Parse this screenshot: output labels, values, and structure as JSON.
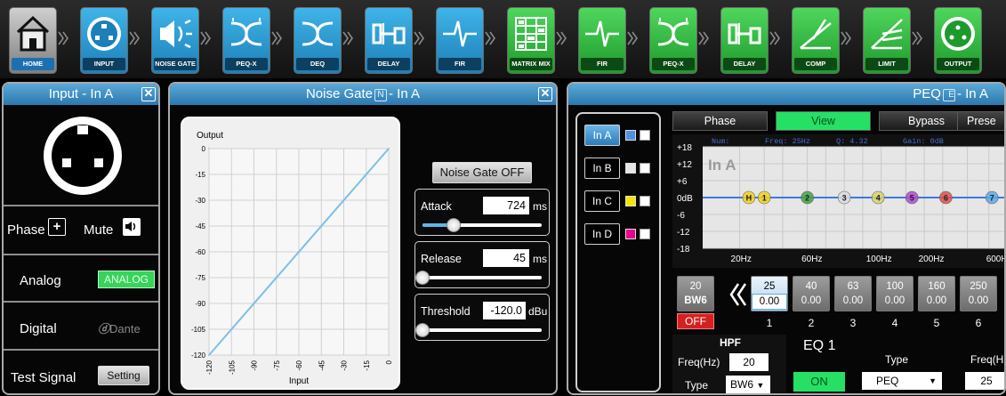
{
  "toolbar": {
    "buttons": [
      {
        "label": "HOME",
        "icon": "home-icon",
        "style": "home"
      },
      {
        "label": "INPUT",
        "icon": "xlr-input-icon",
        "style": "blue"
      },
      {
        "label": "NOISE GATE",
        "icon": "noise-gate-icon",
        "style": "blue"
      },
      {
        "label": "PEQ-X",
        "icon": "peq-x-icon",
        "style": "blue"
      },
      {
        "label": "DEQ",
        "icon": "deq-icon",
        "style": "blue"
      },
      {
        "label": "DELAY",
        "icon": "delay-icon",
        "style": "blue"
      },
      {
        "label": "FIR",
        "icon": "fir-icon",
        "style": "blue"
      },
      {
        "label": "MATRIX MIX",
        "icon": "matrix-icon",
        "style": "green"
      },
      {
        "label": "FIR",
        "icon": "fir-icon",
        "style": "green"
      },
      {
        "label": "PEQ-X",
        "icon": "peq-x-icon",
        "style": "green"
      },
      {
        "label": "DELAY",
        "icon": "delay-icon",
        "style": "green"
      },
      {
        "label": "COMP",
        "icon": "comp-icon",
        "style": "green"
      },
      {
        "label": "LIMIT",
        "icon": "limit-icon",
        "style": "green"
      },
      {
        "label": "OUTPUT",
        "icon": "xlr-output-icon",
        "style": "green"
      }
    ]
  },
  "input_panel": {
    "title": "Input - In A",
    "close": "✕",
    "phase_label": "Phase",
    "phase_value": "+",
    "mute_label": "Mute",
    "analog_label": "Analog",
    "analog_tag": "ANALOG",
    "digital_label": "Digital",
    "digital_tag": "Dante",
    "test_label": "Test Signal",
    "test_button": "Setting"
  },
  "noise_gate": {
    "title_left": "Noise Gate",
    "title_badge": "N",
    "title_right": "- In A",
    "close": "✕",
    "graph": {
      "y_title": "Output",
      "x_title": "Input",
      "y_ticks": [
        "0",
        "-15",
        "-30",
        "-45",
        "-60",
        "-75",
        "-90",
        "-105",
        "-120"
      ],
      "x_ticks": [
        "-120",
        "-105",
        "-90",
        "-75",
        "-60",
        "-45",
        "-30",
        "-15",
        "0"
      ]
    },
    "toggle_label": "Noise Gate OFF",
    "attack": {
      "label": "Attack",
      "value": "724",
      "unit": "ms",
      "level": 0.26
    },
    "release": {
      "label": "Release",
      "value": "45",
      "unit": "ms",
      "level": 0.0
    },
    "threshold": {
      "label": "Threshold",
      "value": "-120.0",
      "unit": "dBu",
      "level": 0.0
    }
  },
  "peq": {
    "title_left": "PEQ",
    "title_badge": "E",
    "title_right": "- In A",
    "channels": [
      {
        "label": "In A",
        "color": "#4f8fe6",
        "selected": true
      },
      {
        "label": "In B",
        "color": "#e6e6e6",
        "selected": false
      },
      {
        "label": "In C",
        "color": "#f2e600",
        "selected": false
      },
      {
        "label": "In D",
        "color": "#e6008c",
        "selected": false
      }
    ],
    "tabs": [
      "Phase",
      "View",
      "Bypass",
      "Prese"
    ],
    "graph": {
      "readout": [
        "Num:",
        "Freq: 25Hz",
        "Q: 4.32",
        "Gain: 0dB"
      ],
      "channel_label": "In A",
      "y_ticks": [
        "+18",
        "+12",
        "+6",
        "0dB",
        "-6",
        "-12",
        "-18"
      ],
      "x_ticks": [
        "20Hz",
        "60Hz",
        "100Hz",
        "200Hz",
        "600H"
      ],
      "markers": [
        "H",
        "1",
        "2",
        "3",
        "4",
        "5",
        "6",
        "7"
      ],
      "marker_colors": [
        "#f2d21a",
        "#f2d21a",
        "#3fa33f",
        "#dcdcdc",
        "#d8d36a",
        "#b24ad1",
        "#e05050",
        "#5aa9e6"
      ]
    },
    "hpf_band": {
      "freq": "20",
      "slope": "BW6",
      "state": "OFF"
    },
    "bands": [
      {
        "num": "1",
        "freq": "25",
        "gain": "0.00"
      },
      {
        "num": "2",
        "freq": "40",
        "gain": "0.00"
      },
      {
        "num": "3",
        "freq": "63",
        "gain": "0.00"
      },
      {
        "num": "4",
        "freq": "100",
        "gain": "0.00"
      },
      {
        "num": "5",
        "freq": "160",
        "gain": "0.00"
      },
      {
        "num": "6",
        "freq": "250",
        "gain": "0.00"
      }
    ],
    "hpf": {
      "title": "HPF",
      "freq_label": "Freq(Hz)",
      "freq_value": "20",
      "type_label": "Type",
      "type_value": "BW6"
    },
    "eq": {
      "title": "EQ 1",
      "on_label": "ON",
      "type_label": "Type",
      "type_value": "PEQ",
      "freq_label": "Freq(Hz",
      "freq_value": "25"
    }
  }
}
